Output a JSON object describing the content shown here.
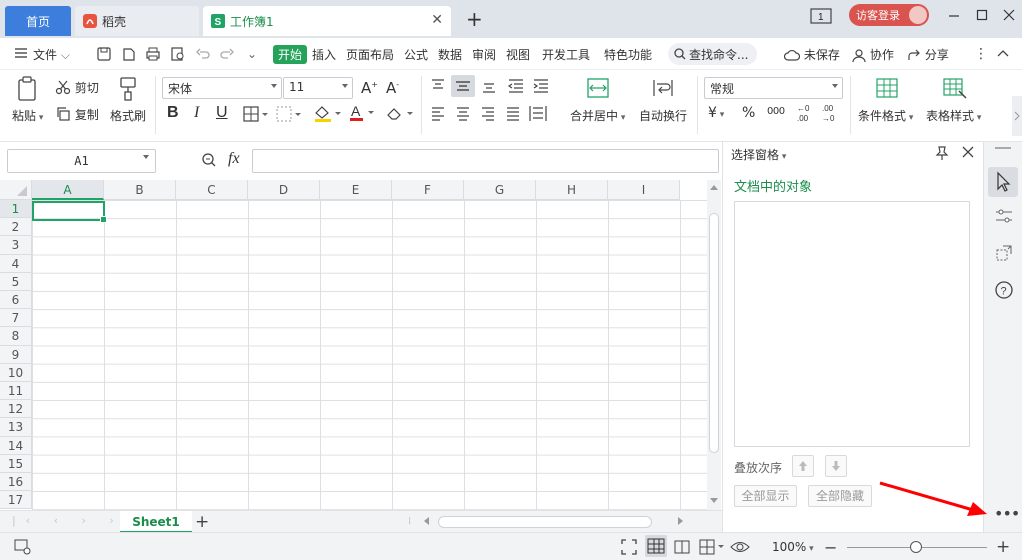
{
  "tabs": {
    "home": "首页",
    "daoke": "稻壳",
    "workbook": "工作簿1"
  },
  "titlebar": {
    "login": "访客登录"
  },
  "menu": {
    "file": "文件",
    "items": [
      "开始",
      "插入",
      "页面布局",
      "公式",
      "数据",
      "审阅",
      "视图",
      "开发工具",
      "特色功能"
    ],
    "search": "查找命令...",
    "unsaved": "未保存",
    "collab": "协作",
    "share": "分享"
  },
  "ribbon": {
    "paste": "粘贴",
    "cut": "剪切",
    "copy": "复制",
    "format_painter": "格式刷",
    "font_name": "宋体",
    "font_size": "11",
    "merge_center": "合并居中",
    "wrap_text": "自动换行",
    "number_format": "常规",
    "conditional_format": "条件格式",
    "table_style": "表格样式"
  },
  "formula_bar": {
    "cell_ref": "A1",
    "fx": "fx",
    "value": ""
  },
  "grid": {
    "columns": [
      "A",
      "B",
      "C",
      "D",
      "E",
      "F",
      "G",
      "H",
      "I"
    ],
    "rows": [
      "1",
      "2",
      "3",
      "4",
      "5",
      "6",
      "7",
      "8",
      "9",
      "10",
      "11",
      "12",
      "13",
      "14",
      "15",
      "16",
      "17"
    ]
  },
  "sheets": {
    "active": "Sheet1"
  },
  "pane": {
    "title": "选择窗格",
    "objects_heading": "文档中的对象",
    "order_label": "叠放次序",
    "show_all": "全部显示",
    "hide_all": "全部隐藏"
  },
  "status": {
    "zoom": "100%"
  },
  "colors": {
    "brand_green": "#21a366",
    "accent_blue": "#3d7ddb",
    "login_red": "#d9534f",
    "annotation_arrow": "#ff0000"
  }
}
